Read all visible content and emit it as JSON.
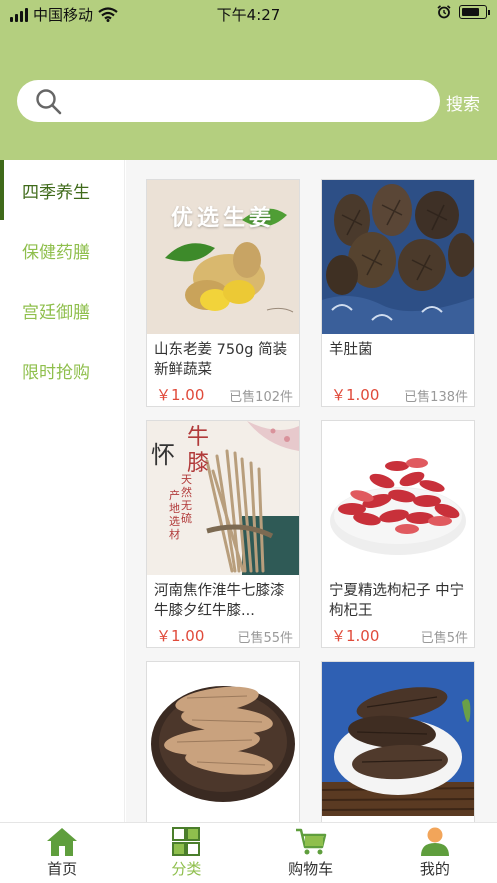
{
  "status_bar": {
    "carrier": "中国移动",
    "time": "下午4:27",
    "battery_level": 0.75
  },
  "search": {
    "placeholder": "",
    "button_label": "搜索"
  },
  "sidebar": {
    "items": [
      {
        "label": "四季养生",
        "active": true
      },
      {
        "label": "保健药膳",
        "active": false
      },
      {
        "label": "宫廷御膳",
        "active": false
      },
      {
        "label": "限时抢购",
        "active": false
      }
    ]
  },
  "products": [
    {
      "name": "山东老姜 750g 简装 新鲜蔬菜",
      "price": "￥1.00",
      "sold": "已售102件",
      "image_text": "优选生姜"
    },
    {
      "name": "羊肚菌",
      "price": "￥1.00",
      "sold": "已售138件"
    },
    {
      "name": "河南焦作淮牛七膝漆牛膝夕红牛膝...",
      "price": "￥1.00",
      "sold": "已售55件",
      "image_text": [
        "怀",
        "牛膝",
        "产地选材",
        "天然无硫"
      ]
    },
    {
      "name": "宁夏精选枸杞子 中宁枸杞王",
      "price": "￥1.00",
      "sold": "已售5件"
    },
    {
      "name": "",
      "price": "",
      "sold": ""
    },
    {
      "name": "",
      "price": "",
      "sold": ""
    }
  ],
  "tabbar": {
    "tabs": [
      {
        "label": "首页",
        "icon": "home-icon"
      },
      {
        "label": "分类",
        "icon": "category-icon",
        "active": true
      },
      {
        "label": "购物车",
        "icon": "cart-icon"
      },
      {
        "label": "我的",
        "icon": "user-icon"
      }
    ]
  },
  "colors": {
    "brand_green": "#b4cf7f",
    "accent_green": "#8fbf4d",
    "price_red": "#e04a3a",
    "active_dark": "#3f6a1a"
  }
}
